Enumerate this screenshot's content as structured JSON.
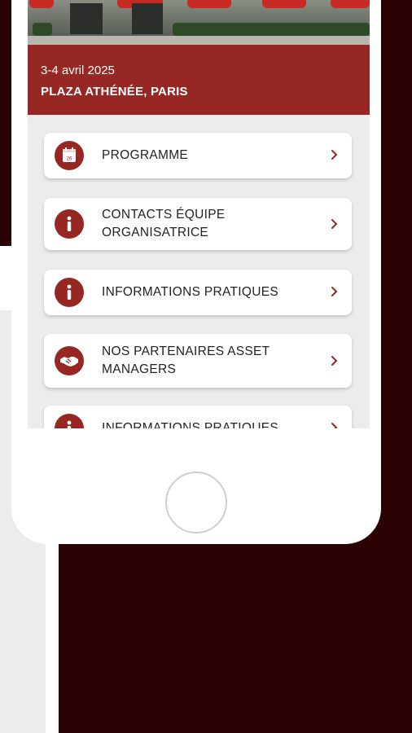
{
  "event": {
    "date": "3-4 avril 2025",
    "venue": "PLAZA ATHÉNÉE, PARIS"
  },
  "menu": {
    "items": [
      {
        "label": "PROGRAMME",
        "icon": "calendar-icon",
        "calendar_day": "26"
      },
      {
        "label": "CONTACTS ÉQUIPE ORGANISATRICE",
        "icon": "info-icon"
      },
      {
        "label": "INFORMATIONS PRATIQUES",
        "icon": "info-icon"
      },
      {
        "label": "NOS PARTENAIRES ASSET MANAGERS",
        "icon": "handshake-icon"
      },
      {
        "label": "INFORMATIONS PRATIQUES",
        "icon": "info-icon"
      }
    ]
  },
  "colors": {
    "brand_red": "#962722",
    "background": "#2a0204",
    "screen_bg": "#ececec"
  }
}
